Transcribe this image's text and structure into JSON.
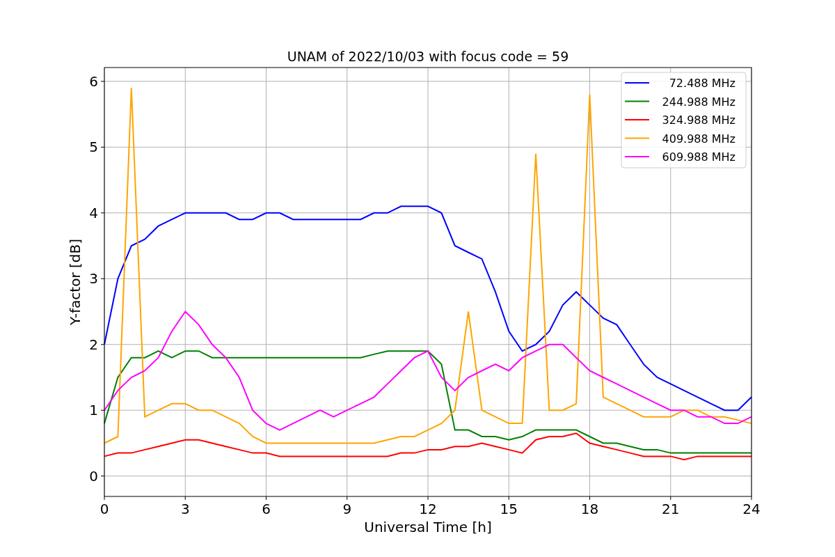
{
  "chart_data": {
    "type": "line",
    "title": "UNAM of 2022/10/03 with focus code = 59",
    "xlabel": "Universal Time [h]",
    "ylabel": "Y-factor [dB]",
    "x": [
      0,
      0.5,
      1,
      1.5,
      2,
      2.5,
      3,
      3.5,
      4,
      4.5,
      5,
      5.5,
      6,
      6.5,
      7,
      7.5,
      8,
      8.5,
      9,
      9.5,
      10,
      10.5,
      11,
      11.5,
      12,
      12.5,
      13,
      13.5,
      14,
      14.5,
      15,
      15.5,
      16,
      16.5,
      17,
      17.5,
      18,
      18.5,
      19,
      19.5,
      20,
      20.5,
      21,
      21.5,
      22,
      22.5,
      23,
      23.5,
      24
    ],
    "grid": true,
    "legend": true,
    "xlim": [
      0,
      24
    ],
    "ylim": [
      -0.31,
      6.21
    ],
    "xticks": [
      0,
      3,
      6,
      9,
      12,
      15,
      18,
      21,
      24
    ],
    "yticks": [
      0,
      1,
      2,
      3,
      4,
      5,
      6
    ],
    "series": [
      {
        "name": "72.488 MHz",
        "color": "#0000ff",
        "values": [
          2.0,
          3.0,
          3.5,
          3.6,
          3.8,
          3.9,
          4.0,
          4.0,
          4.0,
          4.0,
          3.9,
          3.9,
          4.0,
          4.0,
          3.9,
          3.9,
          3.9,
          3.9,
          3.9,
          3.9,
          4.0,
          4.0,
          4.1,
          4.1,
          4.1,
          4.0,
          3.5,
          3.4,
          3.3,
          2.8,
          2.2,
          1.9,
          2.0,
          2.2,
          2.6,
          2.8,
          2.6,
          2.4,
          2.3,
          2.0,
          1.7,
          1.5,
          1.4,
          1.3,
          1.2,
          1.1,
          1.0,
          1.0,
          1.2
        ]
      },
      {
        "name": "244.988 MHz",
        "color": "#008000",
        "values": [
          0.8,
          1.5,
          1.8,
          1.8,
          1.9,
          1.8,
          1.9,
          1.9,
          1.8,
          1.8,
          1.8,
          1.8,
          1.8,
          1.8,
          1.8,
          1.8,
          1.8,
          1.8,
          1.8,
          1.8,
          1.85,
          1.9,
          1.9,
          1.9,
          1.9,
          1.7,
          0.7,
          0.7,
          0.6,
          0.6,
          0.55,
          0.6,
          0.7,
          0.7,
          0.7,
          0.7,
          0.6,
          0.5,
          0.5,
          0.45,
          0.4,
          0.4,
          0.35,
          0.35,
          0.35,
          0.35,
          0.35,
          0.35,
          0.35
        ]
      },
      {
        "name": "324.988 MHz",
        "color": "#ff0000",
        "values": [
          0.3,
          0.35,
          0.35,
          0.4,
          0.45,
          0.5,
          0.55,
          0.55,
          0.5,
          0.45,
          0.4,
          0.35,
          0.35,
          0.3,
          0.3,
          0.3,
          0.3,
          0.3,
          0.3,
          0.3,
          0.3,
          0.3,
          0.35,
          0.35,
          0.4,
          0.4,
          0.45,
          0.45,
          0.5,
          0.45,
          0.4,
          0.35,
          0.55,
          0.6,
          0.6,
          0.65,
          0.5,
          0.45,
          0.4,
          0.35,
          0.3,
          0.3,
          0.3,
          0.25,
          0.3,
          0.3,
          0.3,
          0.3,
          0.3
        ]
      },
      {
        "name": "409.988 MHz",
        "color": "#ffa500",
        "values": [
          0.5,
          0.6,
          5.9,
          0.9,
          1.0,
          1.1,
          1.1,
          1.0,
          1.0,
          0.9,
          0.8,
          0.6,
          0.5,
          0.5,
          0.5,
          0.5,
          0.5,
          0.5,
          0.5,
          0.5,
          0.5,
          0.55,
          0.6,
          0.6,
          0.7,
          0.8,
          1.0,
          2.5,
          1.0,
          0.9,
          0.8,
          0.8,
          4.9,
          1.0,
          1.0,
          1.1,
          5.8,
          1.2,
          1.1,
          1.0,
          0.9,
          0.9,
          0.9,
          1.0,
          1.0,
          0.9,
          0.9,
          0.85,
          0.8
        ]
      },
      {
        "name": "609.988 MHz",
        "color": "#ff00ff",
        "values": [
          1.0,
          1.3,
          1.5,
          1.6,
          1.8,
          2.2,
          2.5,
          2.3,
          2.0,
          1.8,
          1.5,
          1.0,
          0.8,
          0.7,
          0.8,
          0.9,
          1.0,
          0.9,
          1.0,
          1.1,
          1.2,
          1.4,
          1.6,
          1.8,
          1.9,
          1.5,
          1.3,
          1.5,
          1.6,
          1.7,
          1.6,
          1.8,
          1.9,
          2.0,
          2.0,
          1.8,
          1.6,
          1.5,
          1.4,
          1.3,
          1.2,
          1.1,
          1.0,
          1.0,
          0.9,
          0.9,
          0.8,
          0.8,
          0.9
        ]
      }
    ]
  }
}
